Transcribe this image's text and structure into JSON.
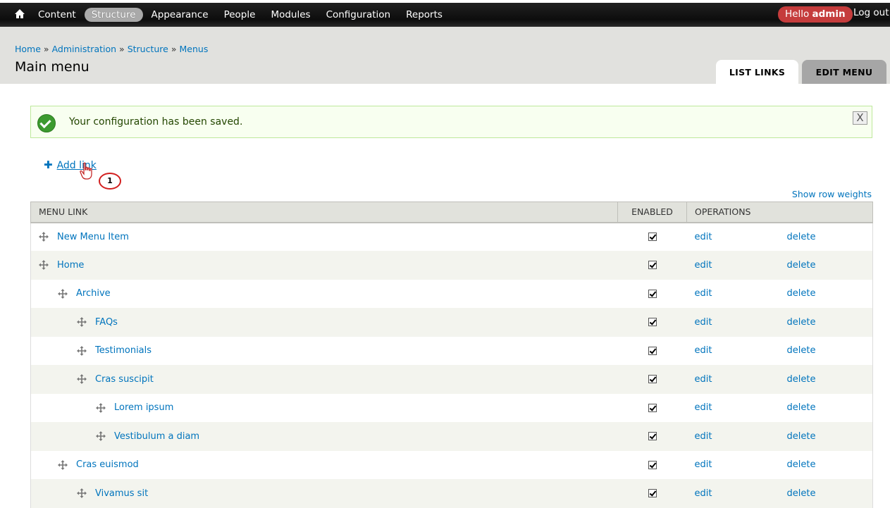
{
  "toolbar": {
    "home_icon": "home-icon",
    "nav": [
      "Content",
      "Structure",
      "Appearance",
      "People",
      "Modules",
      "Configuration",
      "Reports"
    ],
    "active": "Structure",
    "hello_prefix": "Hello",
    "user": "admin",
    "logout": "Log out"
  },
  "breadcrumb": [
    "Home",
    "Administration",
    "Structure",
    "Menus"
  ],
  "breadcrumb_separator": "»",
  "page_title": "Main menu",
  "tabs": {
    "list": "LIST LINKS",
    "edit": "EDIT MENU"
  },
  "message": {
    "text": "Your configuration has been saved.",
    "close": "X"
  },
  "add_link": "Add link",
  "step_marker": "1",
  "show_row_weights": "Show row weights",
  "table": {
    "headers": {
      "menu_link": "MENU LINK",
      "enabled": "ENABLED",
      "operations": "OPERATIONS"
    },
    "rows": [
      {
        "title": "New Menu Item",
        "depth": 0,
        "enabled": true,
        "edit": "edit",
        "delete": "delete"
      },
      {
        "title": "Home",
        "depth": 0,
        "enabled": true,
        "edit": "edit",
        "delete": "delete"
      },
      {
        "title": "Archive",
        "depth": 1,
        "enabled": true,
        "edit": "edit",
        "delete": "delete"
      },
      {
        "title": "FAQs",
        "depth": 2,
        "enabled": true,
        "edit": "edit",
        "delete": "delete"
      },
      {
        "title": "Testimonials",
        "depth": 2,
        "enabled": true,
        "edit": "edit",
        "delete": "delete"
      },
      {
        "title": "Cras suscipit",
        "depth": 2,
        "enabled": true,
        "edit": "edit",
        "delete": "delete"
      },
      {
        "title": "Lorem ipsum",
        "depth": 3,
        "enabled": true,
        "edit": "edit",
        "delete": "delete"
      },
      {
        "title": "Vestibulum a diam",
        "depth": 3,
        "enabled": true,
        "edit": "edit",
        "delete": "delete"
      },
      {
        "title": "Cras euismod",
        "depth": 1,
        "enabled": true,
        "edit": "edit",
        "delete": "delete"
      },
      {
        "title": "Vivamus sit",
        "depth": 2,
        "enabled": true,
        "edit": "edit",
        "delete": "delete"
      }
    ]
  },
  "colors": {
    "link": "#0074bd",
    "toolbar": "#0d0d0d",
    "header_band": "#e1e1de",
    "message_border": "#bee89c",
    "hello_badge": "#c53c3c"
  }
}
